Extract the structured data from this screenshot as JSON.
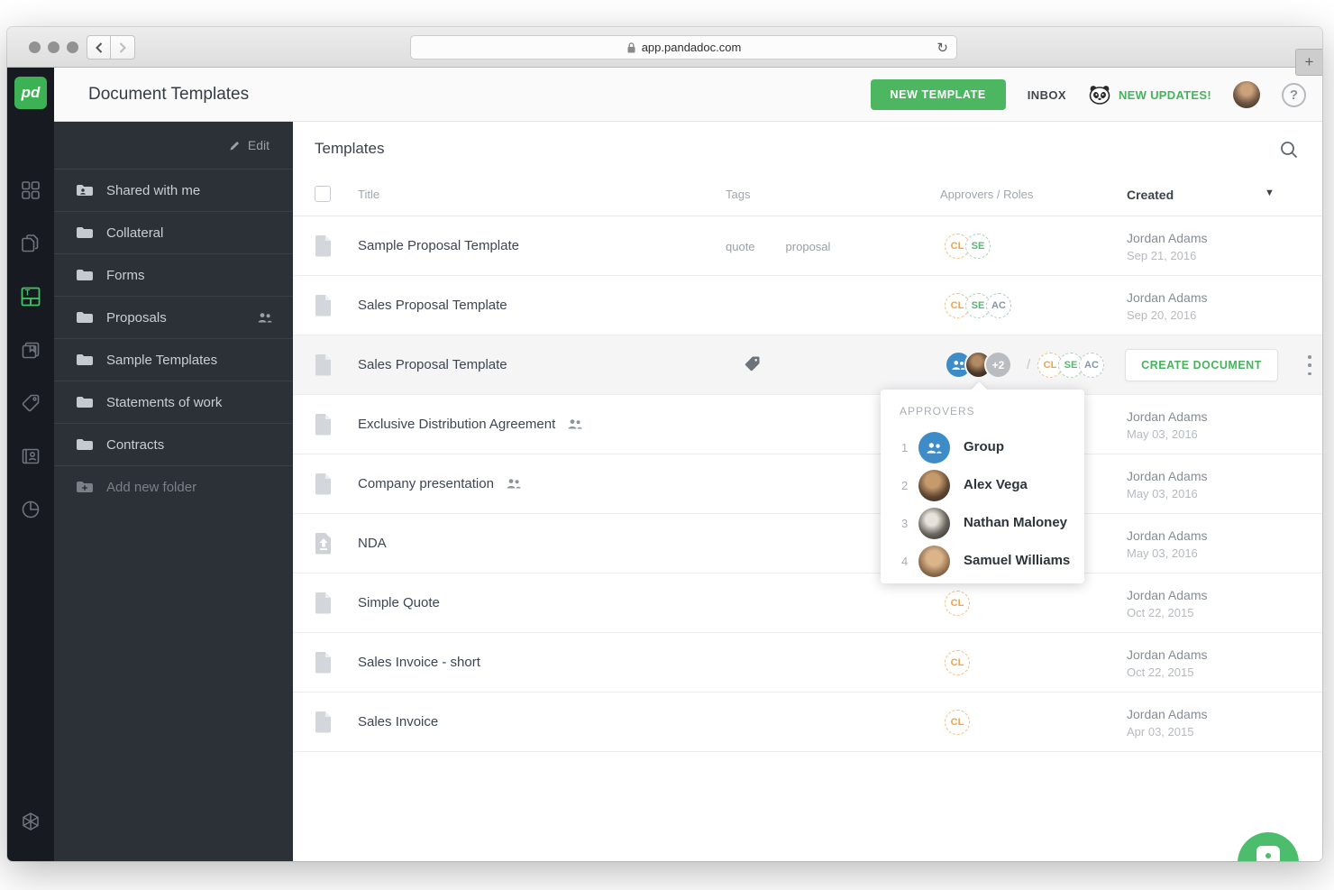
{
  "browser": {
    "url": "app.pandadoc.com",
    "new_tab": "+",
    "refresh": "↻"
  },
  "header": {
    "title": "Document Templates",
    "new_template": "NEW TEMPLATE",
    "inbox": "INBOX",
    "updates": "NEW UPDATES!",
    "help": "?",
    "logo": "pd"
  },
  "rail_icons": [
    "dashboard-icon",
    "documents-icon",
    "templates-icon",
    "content-library-icon",
    "tags-icon",
    "contacts-icon",
    "reports-icon",
    "integrations-icon",
    "settings-icon"
  ],
  "sidebar": {
    "edit": "Edit",
    "items": [
      {
        "label": "Shared with me",
        "icon": "folder-shared-icon"
      },
      {
        "label": "Collateral",
        "icon": "folder-icon"
      },
      {
        "label": "Forms",
        "icon": "folder-icon"
      },
      {
        "label": "Proposals",
        "icon": "folder-icon",
        "shared": true
      },
      {
        "label": "Sample Templates",
        "icon": "folder-icon"
      },
      {
        "label": "Statements of work",
        "icon": "folder-icon"
      },
      {
        "label": "Contracts",
        "icon": "folder-icon"
      },
      {
        "label": "Add new folder",
        "icon": "folder-add-icon"
      }
    ]
  },
  "table": {
    "title": "Templates",
    "columns": {
      "title": "Title",
      "tags": "Tags",
      "approvers": "Approvers / Roles",
      "created": "Created"
    },
    "sort_arrow": "▼",
    "roles_separator": "/",
    "rows": [
      {
        "title": "Sample Proposal Template",
        "tags": [
          "quote",
          "proposal"
        ],
        "roles": [
          "CL",
          "SE"
        ],
        "creator": "Jordan Adams",
        "date": "Sep 21, 2016"
      },
      {
        "title": "Sales Proposal Template",
        "roles": [
          "CL",
          "SE",
          "AC"
        ],
        "creator": "Jordan Adams",
        "date": "Sep 20, 2016"
      },
      {
        "title": "Sales Proposal Template",
        "extra_approvers": "+2",
        "roles": [
          "CL",
          "SE",
          "AC"
        ],
        "action": "CREATE DOCUMENT"
      },
      {
        "title": "Exclusive Distribution Agreement",
        "creator": "Jordan Adams",
        "date": "May 03, 2016"
      },
      {
        "title": "Company presentation",
        "creator": "Jordan Adams",
        "date": "May 03, 2016"
      },
      {
        "title": "NDA",
        "creator": "Jordan Adams",
        "date": "May 03, 2016"
      },
      {
        "title": "Simple Quote",
        "roles": [
          "CL"
        ],
        "creator": "Jordan Adams",
        "date": "Oct 22, 2015"
      },
      {
        "title": "Sales Invoice - short",
        "roles": [
          "CL"
        ],
        "creator": "Jordan Adams",
        "date": "Oct 22, 2015"
      },
      {
        "title": "Sales Invoice",
        "roles": [
          "CL"
        ],
        "creator": "Jordan Adams",
        "date": "Apr 03, 2015"
      }
    ]
  },
  "popup": {
    "title": "APPROVERS",
    "items": [
      {
        "num": "1",
        "name": "Group"
      },
      {
        "num": "2",
        "name": "Alex Vega"
      },
      {
        "num": "3",
        "name": "Nathan Maloney"
      },
      {
        "num": "4",
        "name": "Samuel Williams"
      }
    ]
  },
  "colors": {
    "accent_green": "#4db661",
    "logo_green": "#3db254",
    "rail_dark": "#171a20",
    "sidebar_dark": "#2c3037",
    "role_cl": "#eda44c",
    "role_se": "#56b572",
    "role_ac": "#8295aa",
    "group_blue": "#3e8cc7"
  }
}
